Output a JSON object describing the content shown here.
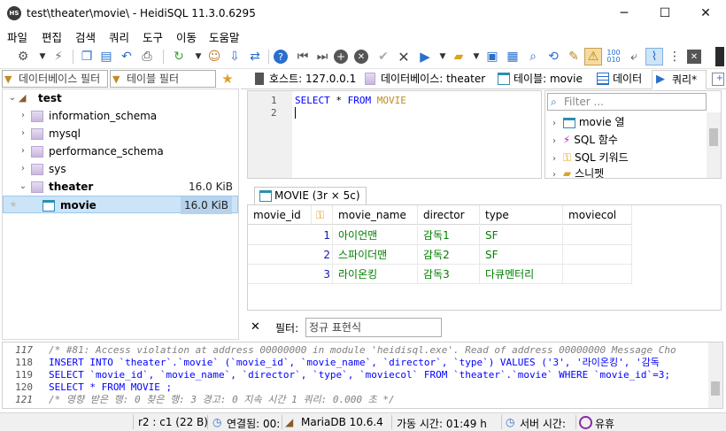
{
  "window": {
    "title": "test\\theater\\movie\\ - HeidiSQL 11.3.0.6295",
    "icon_text": "HS",
    "minimize": "─",
    "maximize": "☐",
    "close": "✕"
  },
  "menu": [
    "파일",
    "편집",
    "검색",
    "쿼리",
    "도구",
    "이동",
    "도움말"
  ],
  "toolbar_icons": [
    "plug-icon",
    "dropdown-icon",
    "disconnect-icon",
    "copy-icon",
    "paste-icon",
    "undo-icon",
    "print-icon",
    "refresh-icon",
    "user-manager-icon",
    "import-icon",
    "export-icon",
    "help-icon",
    "first-icon",
    "last-icon",
    "add-icon",
    "delete-icon",
    "apply-icon",
    "cancel-icon",
    "run-icon",
    "open-folder-icon",
    "save-icon",
    "save-as-icon",
    "find-icon",
    "replace-icon",
    "clear-icon",
    "warning-icon",
    "binary-icon",
    "wrap-icon",
    "format-icon",
    "stop-icon"
  ],
  "left": {
    "db_filter": "데이터베이스 필터",
    "table_filter": "테이블 필터"
  },
  "tree": [
    {
      "label": "test",
      "level": 0,
      "expanded": true,
      "bold": true,
      "size": ""
    },
    {
      "label": "information_schema",
      "level": 1,
      "expanded": false,
      "bold": false,
      "size": ""
    },
    {
      "label": "mysql",
      "level": 1,
      "expanded": false,
      "bold": false,
      "size": ""
    },
    {
      "label": "performance_schema",
      "level": 1,
      "expanded": false,
      "bold": false,
      "size": ""
    },
    {
      "label": "sys",
      "level": 1,
      "expanded": false,
      "bold": false,
      "size": ""
    },
    {
      "label": "theater",
      "level": 1,
      "expanded": true,
      "bold": true,
      "size": "16.0 KiB"
    },
    {
      "label": "movie",
      "level": 2,
      "expanded": false,
      "bold": true,
      "size": "16.0 KiB",
      "selected": true
    }
  ],
  "tabs": [
    "호스트: 127.0.0.1",
    "데이터베이스: theater",
    "테이블: movie",
    "데이터",
    "쿼리*"
  ],
  "editor": {
    "lines": [
      "1",
      "2"
    ],
    "query_kw1": "SELECT",
    "query_star": "*",
    "query_kw2": "FROM",
    "query_table": "MOVIE"
  },
  "helper": {
    "filter_placeholder": "Filter ...",
    "items": [
      "movie 열",
      "SQL 함수",
      "SQL 키워드",
      "스니펫"
    ]
  },
  "result": {
    "tab": "MOVIE (3r × 5c)",
    "columns": [
      "movie_id",
      "movie_name",
      "director",
      "type",
      "moviecol"
    ],
    "rows": [
      [
        "1",
        "아이언맨",
        "감독1",
        "SF",
        ""
      ],
      [
        "2",
        "스파이더맨",
        "감독2",
        "SF",
        ""
      ],
      [
        "3",
        "라이온킹",
        "감독3",
        "다큐멘터리",
        ""
      ]
    ]
  },
  "filterbar": {
    "close": "✕",
    "label": "필터:",
    "value": "정규 표현식"
  },
  "log": [
    {
      "n": "117",
      "text": "/* #81: Access violation at address 00000000 in module 'heidisql.exe'. Read of address 00000000 Message Cho"
    },
    {
      "n": "118",
      "text": "INSERT INTO `theater`.`movie` (`movie_id`, `movie_name`, `director`, `type`) VALUES ('3', '라이온킹', '감독"
    },
    {
      "n": "119",
      "text": "SELECT `movie_id`, `movie_name`, `director`, `type`, `moviecol` FROM `theater`.`movie` WHERE  `movie_id`=3;"
    },
    {
      "n": "120",
      "text": "SELECT * FROM MOVIE  ;"
    },
    {
      "n": "121",
      "text": "/* 영향 받은 행: 0  찾은 행: 3  경고: 0  지속 시간 1 쿼리: 0.000 초 */"
    }
  ],
  "status": {
    "pos": "r2 : c1 (22 B)",
    "connected": "연결됨: 00:",
    "server": "MariaDB 10.6.4",
    "uptime": "가동 시간: 01:49 h",
    "server_time": "서버 시간:",
    "idle": "유휴"
  }
}
